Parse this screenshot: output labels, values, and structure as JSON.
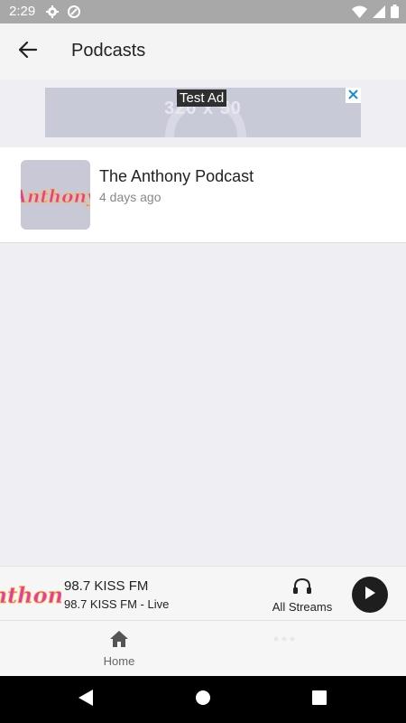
{
  "status_bar": {
    "time": "2:29"
  },
  "app_bar": {
    "title": "Podcasts",
    "back_icon": "arrow-back-icon"
  },
  "ad": {
    "label": "Test Ad",
    "watermark": "320 x 50"
  },
  "podcasts": [
    {
      "title": "The Anthony Podcast",
      "subtitle": "4 days ago",
      "logo_text": "Anthony"
    }
  ],
  "mini_player": {
    "logo_text": "Anthony",
    "station": "98.7 KISS FM",
    "subtitle": "98.7 KISS FM - Live",
    "streams_label": "All Streams"
  },
  "bottom_nav": {
    "home_label": "Home"
  },
  "colors": {
    "status_bar": "#a8a8a8",
    "app_bar": "#f4f4f4",
    "background": "#efeef3",
    "play_button": "#1e1e1e"
  }
}
